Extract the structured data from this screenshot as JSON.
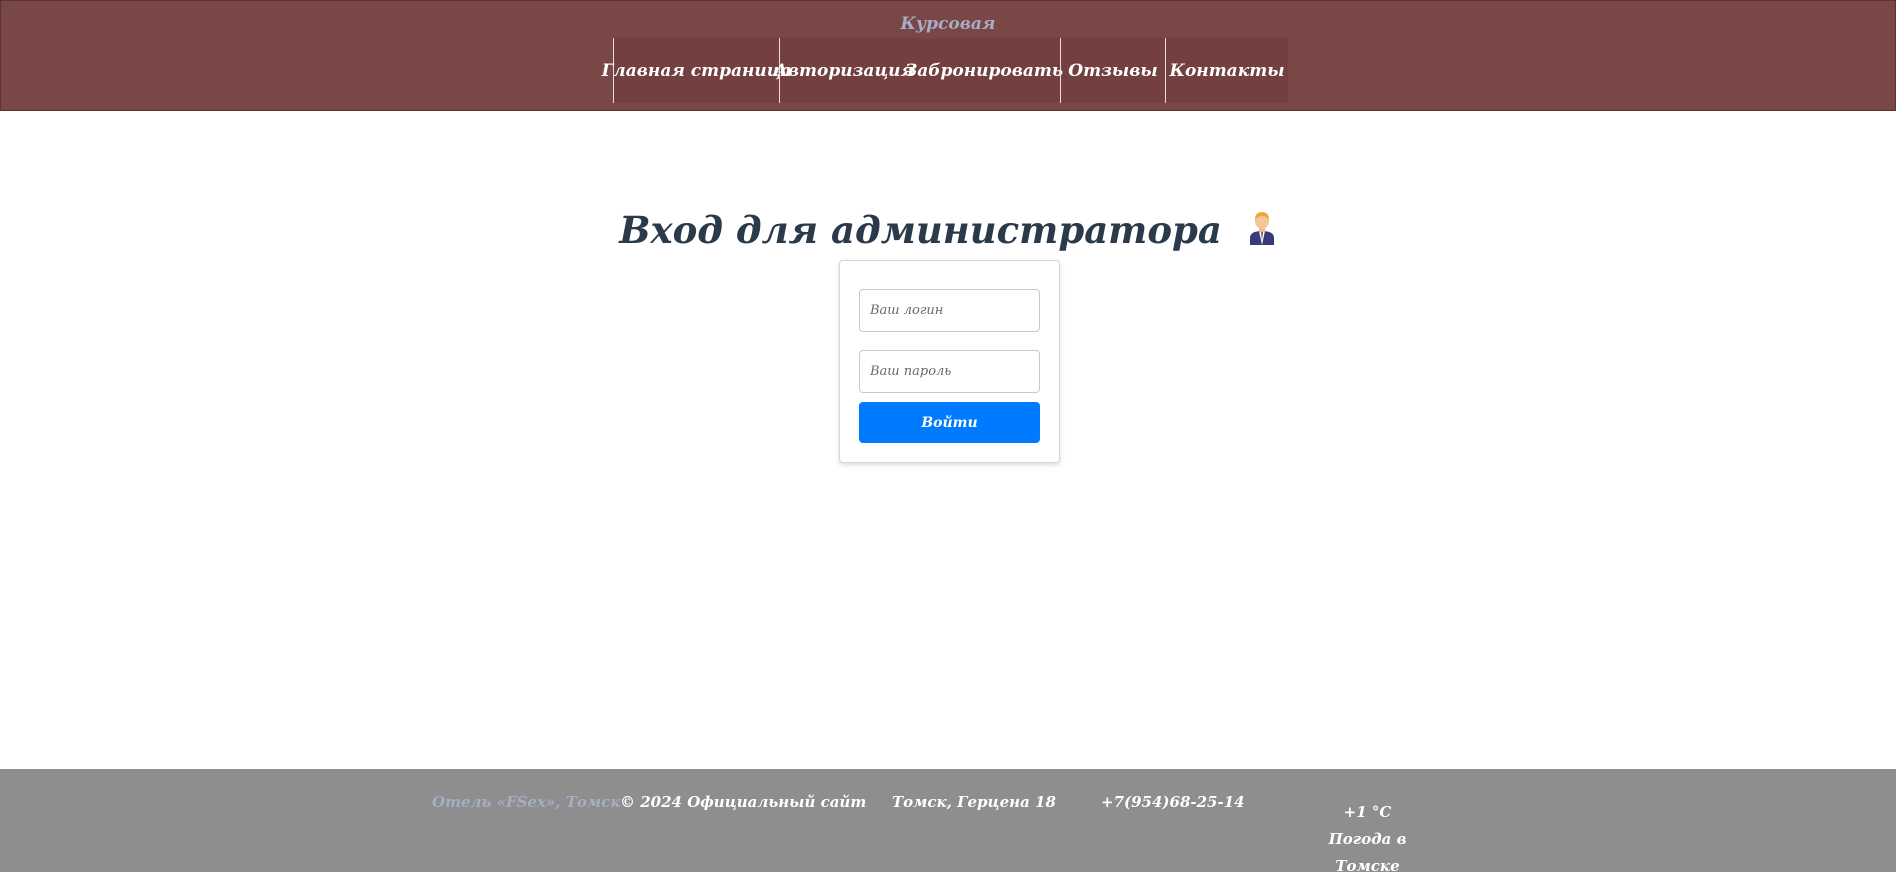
{
  "header": {
    "site_title": "Курсовая",
    "nav": [
      {
        "label": "Главная страница"
      },
      {
        "label": "Авторизация"
      },
      {
        "label": "Забронировать"
      },
      {
        "label": "Отзывы"
      },
      {
        "label": "Контакты"
      }
    ],
    "background_color": "#7a4747"
  },
  "main": {
    "title": "Вход для администратора",
    "title_icon": "admin-person-icon",
    "login_placeholder": "Ваш логин",
    "password_placeholder": "Ваш пароль",
    "submit_label": "Войти",
    "accent_color": "#007bff"
  },
  "footer": {
    "brand": "Отель «FSex», Томск",
    "copyright": "© 2024 Официальный сайт",
    "address": "Томск, Герцена 18",
    "phone": "+7(954)68-25-14",
    "weather": {
      "temperature": "+1 °C",
      "label": "Погода в Томске"
    },
    "background_color": "#8e8e8e"
  }
}
